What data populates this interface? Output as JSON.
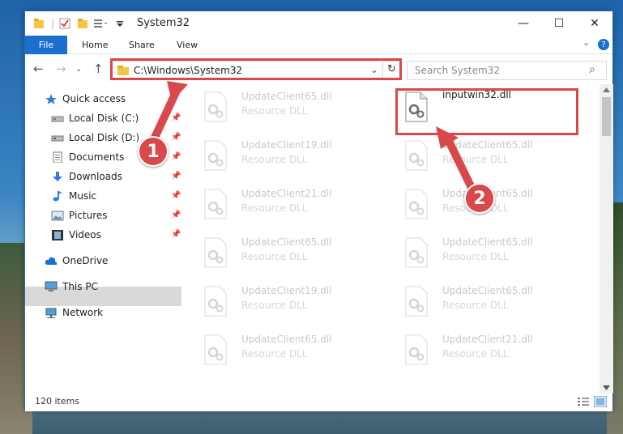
{
  "window": {
    "title": "System32",
    "controls": {
      "minimize": "—",
      "maximize": "☐",
      "close": "✕"
    }
  },
  "ribbon": {
    "file": "File",
    "tabs": [
      "Home",
      "Share",
      "View"
    ],
    "expand": "⌄",
    "help": "?"
  },
  "nav": {
    "back": "←",
    "forward": "→",
    "dropdown": "⌄",
    "up": "↑",
    "address": "C:\\Windows\\System32",
    "refresh": "↻",
    "search_placeholder": "Search System32",
    "search_icon": "⌕"
  },
  "sidebar": {
    "items": [
      {
        "label": "Quick access",
        "icon": "star-icon",
        "pinned": false
      },
      {
        "label": "Local Disk (C:)",
        "icon": "drive-icon",
        "pinned": true
      },
      {
        "label": "Local Disk (D:)",
        "icon": "drive-icon",
        "pinned": true
      },
      {
        "label": "Documents",
        "icon": "documents-icon",
        "pinned": true
      },
      {
        "label": "Downloads",
        "icon": "download-icon",
        "pinned": true
      },
      {
        "label": "Music",
        "icon": "music-icon",
        "pinned": true
      },
      {
        "label": "Pictures",
        "icon": "pictures-icon",
        "pinned": true
      },
      {
        "label": "Videos",
        "icon": "videos-icon",
        "pinned": true
      },
      {
        "label": "OneDrive",
        "icon": "cloud-icon",
        "pinned": false
      },
      {
        "label": "This PC",
        "icon": "computer-icon",
        "pinned": false,
        "selected": true
      },
      {
        "label": "Network",
        "icon": "network-icon",
        "pinned": false
      }
    ],
    "pin_glyph": "📌"
  },
  "files": [
    {
      "name": "UpdateClient65.dll",
      "type": "Resource DLL"
    },
    {
      "name": "inputwin32.dll",
      "type": ""
    },
    {
      "name": "UpdateClient19.dll",
      "type": "Resource DLL"
    },
    {
      "name": "UpdateClient65.dll",
      "type": "Resource DLL"
    },
    {
      "name": "UpdateClient21.dll",
      "type": "Resource DLL"
    },
    {
      "name": "UpdateClient65.dll",
      "type": "Resource DLL"
    },
    {
      "name": "UpdateClient65.dll",
      "type": "Resource DLL"
    },
    {
      "name": "UpdateClient65.dll",
      "type": "Resource DLL"
    },
    {
      "name": "UpdateClient19.dll",
      "type": "Resource DLL"
    },
    {
      "name": "UpdateClient65.dll",
      "type": "Resource DLL"
    },
    {
      "name": "UpdateClient65.dll",
      "type": "Resource DLL"
    },
    {
      "name": "UpdateClient21.dll",
      "type": "Resource DLL"
    }
  ],
  "status": {
    "items": "120 items"
  },
  "callouts": {
    "one": "1",
    "two": "2"
  },
  "colors": {
    "accent": "#1a6fcf",
    "highlight": "#d9484a"
  }
}
